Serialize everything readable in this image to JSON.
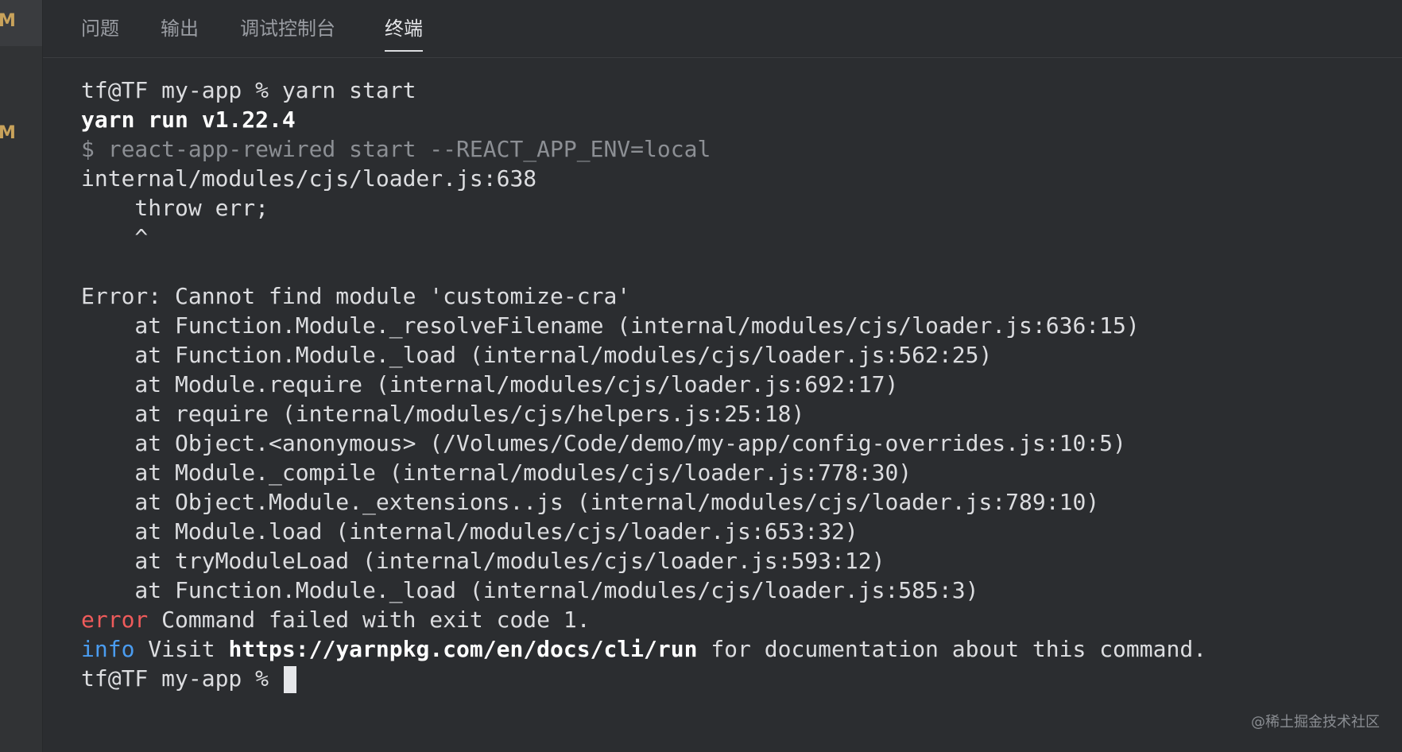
{
  "gutter": {
    "markers": [
      "M",
      "M"
    ],
    "marker_color": "#c9a35b"
  },
  "tabs": [
    {
      "label": "问题",
      "active": false
    },
    {
      "label": "输出",
      "active": false
    },
    {
      "label": "调试控制台",
      "active": false
    },
    {
      "label": "终端",
      "active": true
    }
  ],
  "terminal": {
    "lines": {
      "l1": "tf@TF my-app % yarn start",
      "l2": "yarn run v1.22.4",
      "l3": "$ react-app-rewired start --REACT_APP_ENV=local",
      "l4": "internal/modules/cjs/loader.js:638",
      "l5": "    throw err;",
      "l6": "    ^",
      "l7": "",
      "l8": "Error: Cannot find module 'customize-cra'",
      "l9": "    at Function.Module._resolveFilename (internal/modules/cjs/loader.js:636:15)",
      "l10": "    at Function.Module._load (internal/modules/cjs/loader.js:562:25)",
      "l11": "    at Module.require (internal/modules/cjs/loader.js:692:17)",
      "l12": "    at require (internal/modules/cjs/helpers.js:25:18)",
      "l13": "    at Object.<anonymous> (/Volumes/Code/demo/my-app/config-overrides.js:10:5)",
      "l14": "    at Module._compile (internal/modules/cjs/loader.js:778:30)",
      "l15": "    at Object.Module._extensions..js (internal/modules/cjs/loader.js:789:10)",
      "l16": "    at Module.load (internal/modules/cjs/loader.js:653:32)",
      "l17": "    at tryModuleLoad (internal/modules/cjs/loader.js:593:12)",
      "l18": "    at Function.Module._load (internal/modules/cjs/loader.js:585:3)"
    },
    "error_line": {
      "tag": "error",
      "text": " Command failed with exit code 1."
    },
    "info_line": {
      "tag": "info",
      "pre": " Visit ",
      "link": "https://yarnpkg.com/en/docs/cli/run",
      "post": " for documentation about this command."
    },
    "prompt": "tf@TF my-app % "
  },
  "watermark": "@稀土掘金技术社区",
  "colors": {
    "background": "#2b2d30",
    "text": "#dcdde0",
    "dim": "#8c8f94",
    "error": "#ef5b5b",
    "info": "#4a9cf0"
  }
}
